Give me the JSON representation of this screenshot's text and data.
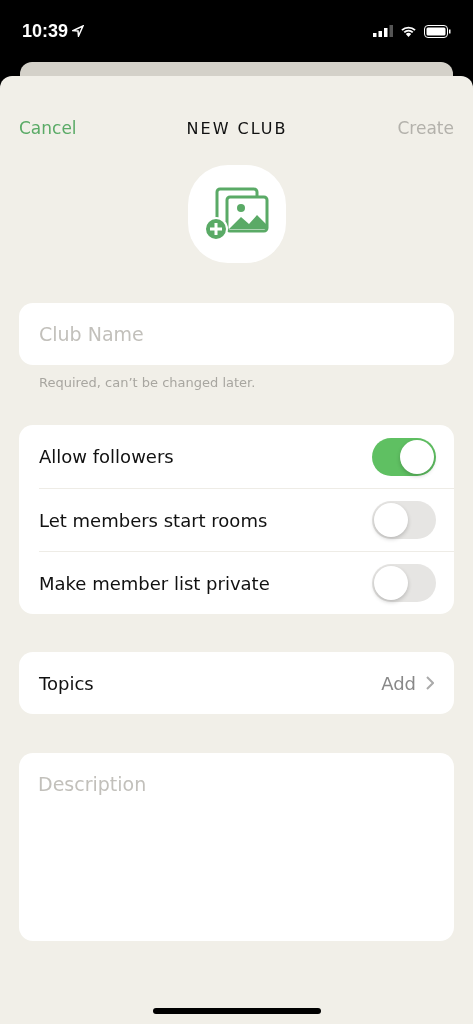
{
  "status_bar": {
    "time": "10:39"
  },
  "nav": {
    "cancel": "Cancel",
    "title": "NEW CLUB",
    "create": "Create",
    "create_disabled": true
  },
  "club_name": {
    "placeholder": "Club Name",
    "hint": "Required, can’t be changed later."
  },
  "toggles": [
    {
      "label": "Allow followers",
      "on": true
    },
    {
      "label": "Let members start rooms",
      "on": false
    },
    {
      "label": "Make member list private",
      "on": false
    }
  ],
  "topics": {
    "label": "Topics",
    "action": "Add"
  },
  "description": {
    "placeholder": "Description"
  }
}
